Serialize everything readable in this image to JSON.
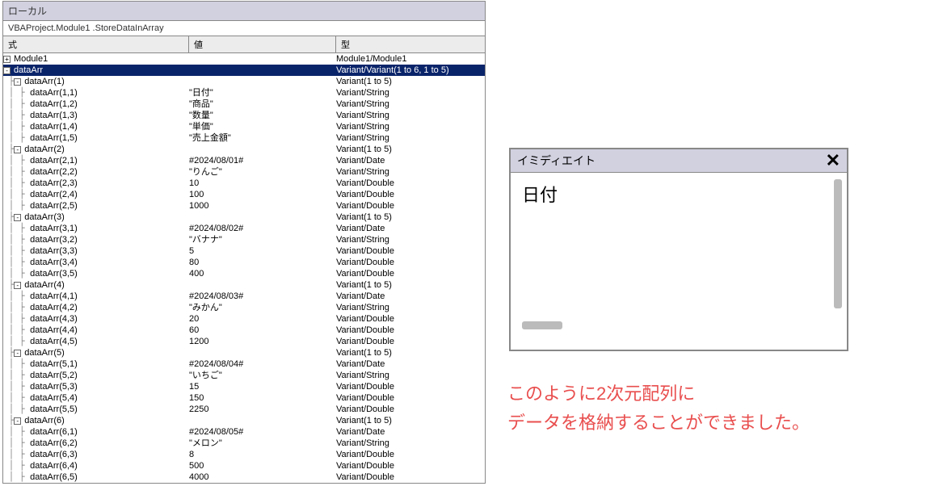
{
  "locals": {
    "title": "ローカル",
    "context": "VBAProject.Module1 .StoreDataInArray",
    "headers": {
      "expr": "式",
      "val": "値",
      "type": "型"
    },
    "rows": [
      {
        "lvl": 0,
        "glyph": "+",
        "expr": "Module1",
        "val": "",
        "type": "Module1/Module1",
        "sel": false
      },
      {
        "lvl": 0,
        "glyph": "-",
        "expr": "dataArr",
        "val": "",
        "type": "Variant/Variant(1 to 6, 1 to 5)",
        "sel": true
      },
      {
        "lvl": 1,
        "glyph": "-",
        "expr": "dataArr(1)",
        "val": "",
        "type": "Variant(1 to 5)",
        "sel": false
      },
      {
        "lvl": 2,
        "glyph": "",
        "expr": "dataArr(1,1)",
        "val": "\"日付\"",
        "type": "Variant/String",
        "sel": false
      },
      {
        "lvl": 2,
        "glyph": "",
        "expr": "dataArr(1,2)",
        "val": "\"商品\"",
        "type": "Variant/String",
        "sel": false
      },
      {
        "lvl": 2,
        "glyph": "",
        "expr": "dataArr(1,3)",
        "val": "\"数量\"",
        "type": "Variant/String",
        "sel": false
      },
      {
        "lvl": 2,
        "glyph": "",
        "expr": "dataArr(1,4)",
        "val": "\"単価\"",
        "type": "Variant/String",
        "sel": false
      },
      {
        "lvl": 2,
        "glyph": "",
        "expr": "dataArr(1,5)",
        "val": "\"売上金額\"",
        "type": "Variant/String",
        "sel": false
      },
      {
        "lvl": 1,
        "glyph": "-",
        "expr": "dataArr(2)",
        "val": "",
        "type": "Variant(1 to 5)",
        "sel": false
      },
      {
        "lvl": 2,
        "glyph": "",
        "expr": "dataArr(2,1)",
        "val": "#2024/08/01#",
        "type": "Variant/Date",
        "sel": false
      },
      {
        "lvl": 2,
        "glyph": "",
        "expr": "dataArr(2,2)",
        "val": "\"りんご\"",
        "type": "Variant/String",
        "sel": false
      },
      {
        "lvl": 2,
        "glyph": "",
        "expr": "dataArr(2,3)",
        "val": "10",
        "type": "Variant/Double",
        "sel": false
      },
      {
        "lvl": 2,
        "glyph": "",
        "expr": "dataArr(2,4)",
        "val": "100",
        "type": "Variant/Double",
        "sel": false
      },
      {
        "lvl": 2,
        "glyph": "",
        "expr": "dataArr(2,5)",
        "val": "1000",
        "type": "Variant/Double",
        "sel": false
      },
      {
        "lvl": 1,
        "glyph": "-",
        "expr": "dataArr(3)",
        "val": "",
        "type": "Variant(1 to 5)",
        "sel": false
      },
      {
        "lvl": 2,
        "glyph": "",
        "expr": "dataArr(3,1)",
        "val": "#2024/08/02#",
        "type": "Variant/Date",
        "sel": false
      },
      {
        "lvl": 2,
        "glyph": "",
        "expr": "dataArr(3,2)",
        "val": "\"バナナ\"",
        "type": "Variant/String",
        "sel": false
      },
      {
        "lvl": 2,
        "glyph": "",
        "expr": "dataArr(3,3)",
        "val": "5",
        "type": "Variant/Double",
        "sel": false
      },
      {
        "lvl": 2,
        "glyph": "",
        "expr": "dataArr(3,4)",
        "val": "80",
        "type": "Variant/Double",
        "sel": false
      },
      {
        "lvl": 2,
        "glyph": "",
        "expr": "dataArr(3,5)",
        "val": "400",
        "type": "Variant/Double",
        "sel": false
      },
      {
        "lvl": 1,
        "glyph": "-",
        "expr": "dataArr(4)",
        "val": "",
        "type": "Variant(1 to 5)",
        "sel": false
      },
      {
        "lvl": 2,
        "glyph": "",
        "expr": "dataArr(4,1)",
        "val": "#2024/08/03#",
        "type": "Variant/Date",
        "sel": false
      },
      {
        "lvl": 2,
        "glyph": "",
        "expr": "dataArr(4,2)",
        "val": "\"みかん\"",
        "type": "Variant/String",
        "sel": false
      },
      {
        "lvl": 2,
        "glyph": "",
        "expr": "dataArr(4,3)",
        "val": "20",
        "type": "Variant/Double",
        "sel": false
      },
      {
        "lvl": 2,
        "glyph": "",
        "expr": "dataArr(4,4)",
        "val": "60",
        "type": "Variant/Double",
        "sel": false
      },
      {
        "lvl": 2,
        "glyph": "",
        "expr": "dataArr(4,5)",
        "val": "1200",
        "type": "Variant/Double",
        "sel": false
      },
      {
        "lvl": 1,
        "glyph": "-",
        "expr": "dataArr(5)",
        "val": "",
        "type": "Variant(1 to 5)",
        "sel": false
      },
      {
        "lvl": 2,
        "glyph": "",
        "expr": "dataArr(5,1)",
        "val": "#2024/08/04#",
        "type": "Variant/Date",
        "sel": false
      },
      {
        "lvl": 2,
        "glyph": "",
        "expr": "dataArr(5,2)",
        "val": "\"いちご\"",
        "type": "Variant/String",
        "sel": false
      },
      {
        "lvl": 2,
        "glyph": "",
        "expr": "dataArr(5,3)",
        "val": "15",
        "type": "Variant/Double",
        "sel": false
      },
      {
        "lvl": 2,
        "glyph": "",
        "expr": "dataArr(5,4)",
        "val": "150",
        "type": "Variant/Double",
        "sel": false
      },
      {
        "lvl": 2,
        "glyph": "",
        "expr": "dataArr(5,5)",
        "val": "2250",
        "type": "Variant/Double",
        "sel": false
      },
      {
        "lvl": 1,
        "glyph": "-",
        "expr": "dataArr(6)",
        "val": "",
        "type": "Variant(1 to 5)",
        "sel": false
      },
      {
        "lvl": 2,
        "glyph": "",
        "expr": "dataArr(6,1)",
        "val": "#2024/08/05#",
        "type": "Variant/Date",
        "sel": false
      },
      {
        "lvl": 2,
        "glyph": "",
        "expr": "dataArr(6,2)",
        "val": "\"メロン\"",
        "type": "Variant/String",
        "sel": false
      },
      {
        "lvl": 2,
        "glyph": "",
        "expr": "dataArr(6,3)",
        "val": "8",
        "type": "Variant/Double",
        "sel": false
      },
      {
        "lvl": 2,
        "glyph": "",
        "expr": "dataArr(6,4)",
        "val": "500",
        "type": "Variant/Double",
        "sel": false
      },
      {
        "lvl": 2,
        "glyph": "",
        "expr": "dataArr(6,5)",
        "val": "4000",
        "type": "Variant/Double",
        "sel": false
      }
    ]
  },
  "immediate": {
    "title": "イミディエイト",
    "content": "日付"
  },
  "annotation": {
    "line1": "このように2次元配列に",
    "line2": "データを格納することができました。"
  }
}
